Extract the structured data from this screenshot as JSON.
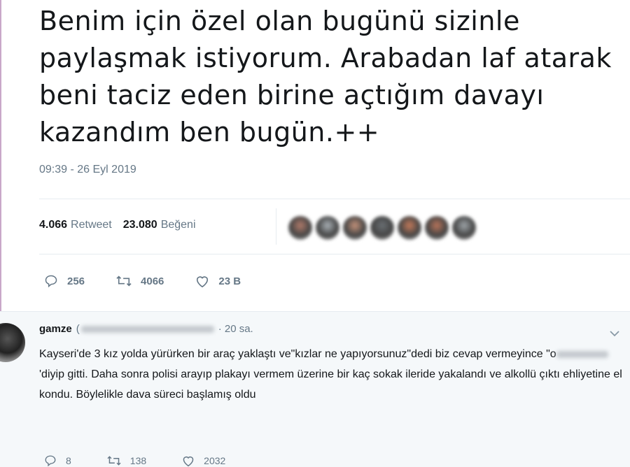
{
  "tweet": {
    "text": "Benim için özel olan bugünü sizinle paylaşmak istiyorum. Arabadan laf atarak beni taciz eden birine açtığım davayı kazandım ben bugün.++",
    "timestamp": "09:39 - 26 Eyl 2019",
    "retweet_count": "4.066",
    "retweet_label": "Retweet",
    "like_count": "23.080",
    "like_label": "Beğeni",
    "liker_avatar_colors": [
      "#b07a6a",
      "#a9b0b5",
      "#c4927a",
      "#6a6f73",
      "#c47a5a",
      "#b8745a",
      "#9ea4a8"
    ],
    "actions": {
      "replies": "256",
      "retweets": "4066",
      "likes": "23 B"
    }
  },
  "reply": {
    "name": "gamze",
    "handle_prefix": "(",
    "time": "· 20 sa.",
    "text_part1": "Kayseri'de 3 kız yolda yürürken bir araç yaklaştı ve\"kızlar ne yapıyorsunuz\"dedi biz cevap vermeyince \"o",
    "text_part2": "'diyip gitti. Daha sonra polisi arayıp plakayı vermem üzerine bir kaç sokak ileride yakalandı ve alkollü çıktı ehliyetine el kondu. Böylelikle dava süreci başlamış oldu",
    "actions": {
      "replies": "8",
      "retweets": "138",
      "likes": "2032"
    }
  },
  "colors": {
    "text": "#14171a",
    "secondary": "#657786",
    "divider": "#e6ecf0",
    "reply_bg": "#f5f8fa"
  }
}
